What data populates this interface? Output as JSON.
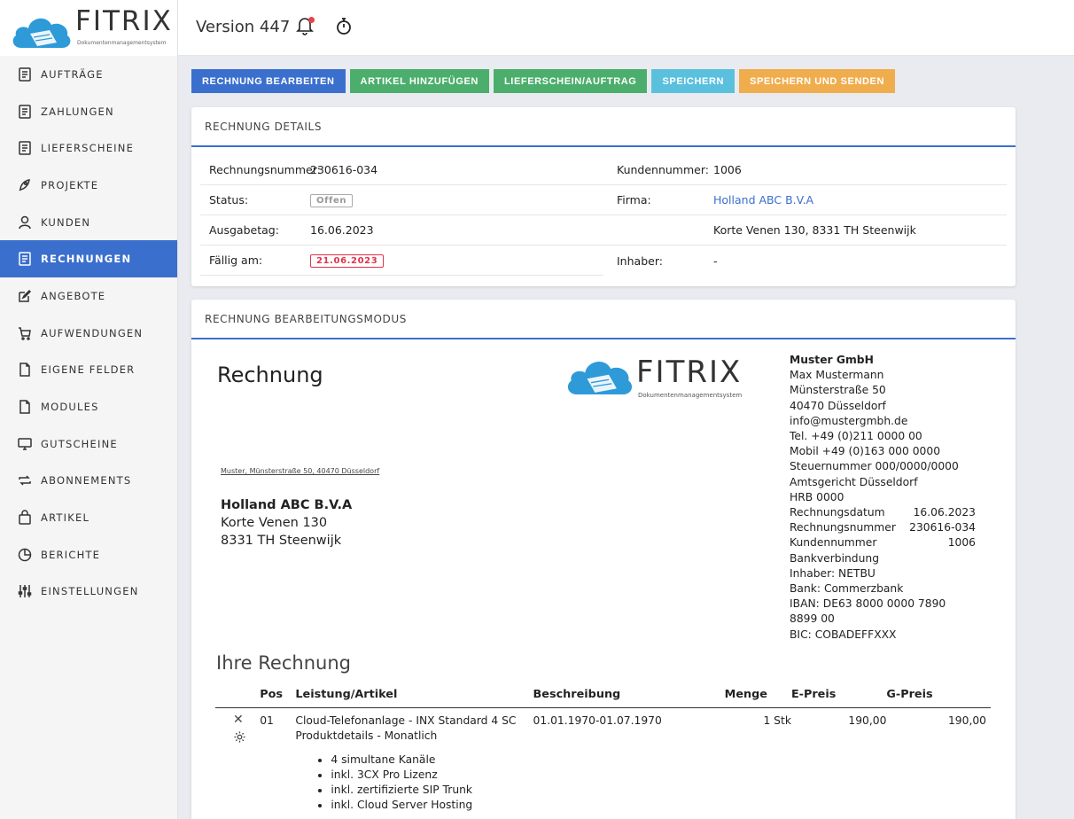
{
  "app": {
    "logo_text": "FITRIX",
    "logo_tagline": "Dokumentenmanagementsystem",
    "version": "Version 447"
  },
  "sidebar": {
    "items": [
      {
        "label": "AUFTRÄGE",
        "icon": "document-icon"
      },
      {
        "label": "ZAHLUNGEN",
        "icon": "document-icon"
      },
      {
        "label": "LIEFERSCHEINE",
        "icon": "document-icon"
      },
      {
        "label": "PROJEKTE",
        "icon": "rocket-icon"
      },
      {
        "label": "KUNDEN",
        "icon": "user-icon"
      },
      {
        "label": "RECHNUNGEN",
        "icon": "document-icon",
        "active": true
      },
      {
        "label": "ANGEBOTE",
        "icon": "edit-icon"
      },
      {
        "label": "AUFWENDUNGEN",
        "icon": "cart-icon"
      },
      {
        "label": "EIGENE FELDER",
        "icon": "file-icon"
      },
      {
        "label": "MODULES",
        "icon": "file-icon"
      },
      {
        "label": "GUTSCHEINE",
        "icon": "monitor-icon"
      },
      {
        "label": "ABONNEMENTS",
        "icon": "repeat-icon"
      },
      {
        "label": "ARTIKEL",
        "icon": "bag-icon"
      },
      {
        "label": "BERICHTE",
        "icon": "pie-chart-icon"
      },
      {
        "label": "EINSTELLUNGEN",
        "icon": "sliders-icon"
      }
    ]
  },
  "toolbar": {
    "edit": "RECHNUNG BEARBEITEN",
    "add_article": "ARTIKEL HINZUFÜGEN",
    "delivery": "LIEFERSCHEIN/AUFTRAG",
    "save": "SPEICHERN",
    "save_send": "SPEICHERN UND SENDEN"
  },
  "colors": {
    "primary": "#3b6fce",
    "success": "#4cae6c",
    "info": "#5bc0de",
    "warning": "#f0ad4e",
    "danger": "#e0344a"
  },
  "details": {
    "title": "RECHNUNG DETAILS",
    "left": [
      {
        "label": "Rechnungsnummer:",
        "value": "230616-034"
      },
      {
        "label": "Status:",
        "badge": "Offen"
      },
      {
        "label": "Ausgabetag:",
        "value": "16.06.2023"
      },
      {
        "label": "Fällig am:",
        "badge": "21.06.2023"
      }
    ],
    "right": [
      {
        "label": "Kundennummer:",
        "value": "1006"
      },
      {
        "label": "Firma:",
        "value": "Holland ABC B.V.A"
      },
      {
        "label": "",
        "value": "Korte Venen 130, 8331 TH Steenwijk"
      },
      {
        "label": "Inhaber:",
        "value": "-"
      }
    ]
  },
  "editor": {
    "title": "RECHNUNG BEARBEITUNGSMODUS",
    "doc_title": "Rechnung",
    "return_address": "Muster, Münsterstraße 50, 40470 Düsseldorf",
    "recipient": {
      "name": "Holland ABC B.V.A",
      "street": "Korte Venen 130",
      "city": "8331 TH Steenwijk"
    },
    "sender": {
      "company": "Muster GmbH",
      "lines": [
        "Max Mustermann",
        "Münsterstraße 50",
        "40470 Düsseldorf",
        "info@mustergmbh.de",
        "Tel. +49 (0)211 0000 00",
        "Mobil +49 (0)163 000 0000",
        "Steuernummer 000/0000/0000",
        "Amtsgericht Düsseldorf",
        "HRB 0000"
      ],
      "kv": [
        {
          "k": "Rechnungsdatum",
          "v": "16.06.2023"
        },
        {
          "k": "Rechnungsnummer",
          "v": "230616-034"
        },
        {
          "k": "Kundennummer",
          "v": "1006"
        }
      ],
      "bank_lines": [
        "Bankverbindung",
        "Inhaber: NETBU",
        "Bank: Commerzbank",
        "IBAN: DE63 8000 0000 7890",
        "8899 00",
        "BIC: COBADEFFXXX"
      ]
    },
    "section_heading": "Ihre Rechnung",
    "table": {
      "headers": {
        "pos": "Pos",
        "article": "Leistung/Artikel",
        "description": "Beschreibung",
        "qty": "Menge",
        "unit_price": "E-Preis",
        "total": "G-Preis"
      },
      "rows": [
        {
          "pos": "01",
          "article": "Cloud-Telefonanlage - INX Standard 4 SC",
          "details": "Produktdetails - Monatlich",
          "bullets": [
            "4 simultane Kanäle",
            "inkl. 3CX Pro Lizenz",
            "inkl. zertifizierte SIP Trunk",
            "inkl. Cloud Server Hosting"
          ],
          "description": "01.01.1970-01.07.1970",
          "qty": "1 Stk",
          "unit_price": "190,00",
          "total": "190,00"
        }
      ]
    }
  }
}
